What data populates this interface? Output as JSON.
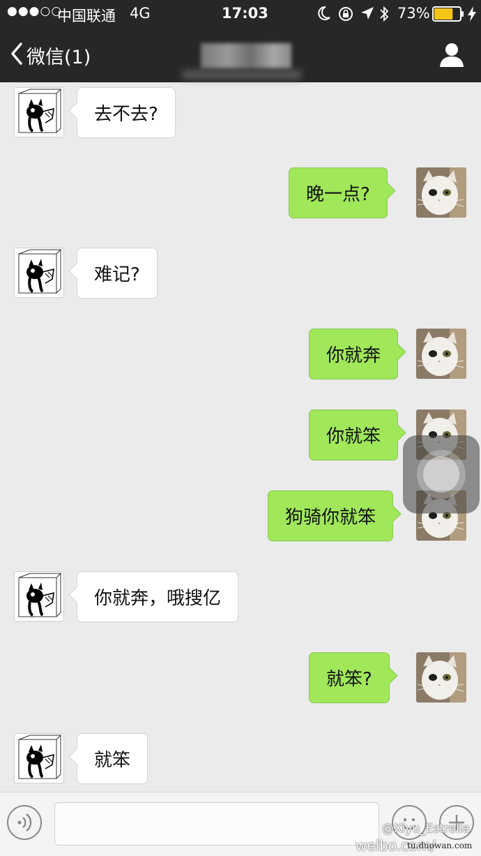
{
  "status_bar": {
    "signal": "●●●○○",
    "carrier": "中国联通",
    "network": "4G",
    "time": "17:03",
    "battery": "73%",
    "battery_level": 0.73
  },
  "nav": {
    "back_label": "微信(1)",
    "contact_icon": "person-icon"
  },
  "messages": [
    {
      "side": "left",
      "text": "去不去?"
    },
    {
      "side": "right",
      "text": "晚一点?"
    },
    {
      "side": "left",
      "text": "难记?"
    },
    {
      "side": "right",
      "text": "你就奔"
    },
    {
      "side": "right",
      "text": "你就笨"
    },
    {
      "side": "right",
      "text": "狗骑你就笨"
    },
    {
      "side": "left",
      "text": "你就奔，哦搜亿"
    },
    {
      "side": "right",
      "text": "就笨?"
    },
    {
      "side": "left",
      "text": "就笨"
    }
  ],
  "input_bar": {
    "voice_icon": "voice-icon",
    "emoji_icon": "emoji-icon",
    "plus_icon": "plus-icon",
    "placeholder": ""
  },
  "watermark": {
    "line1": "@Xiyu_Estrella",
    "line2": "weibo.com/",
    "line3": "tu.duowan.com"
  },
  "colors": {
    "header": "#272727",
    "chat_background": "#ebebeb",
    "sent_bubble": "#a0e75a",
    "received_bubble": "#ffffff",
    "battery": "#f5c518"
  }
}
